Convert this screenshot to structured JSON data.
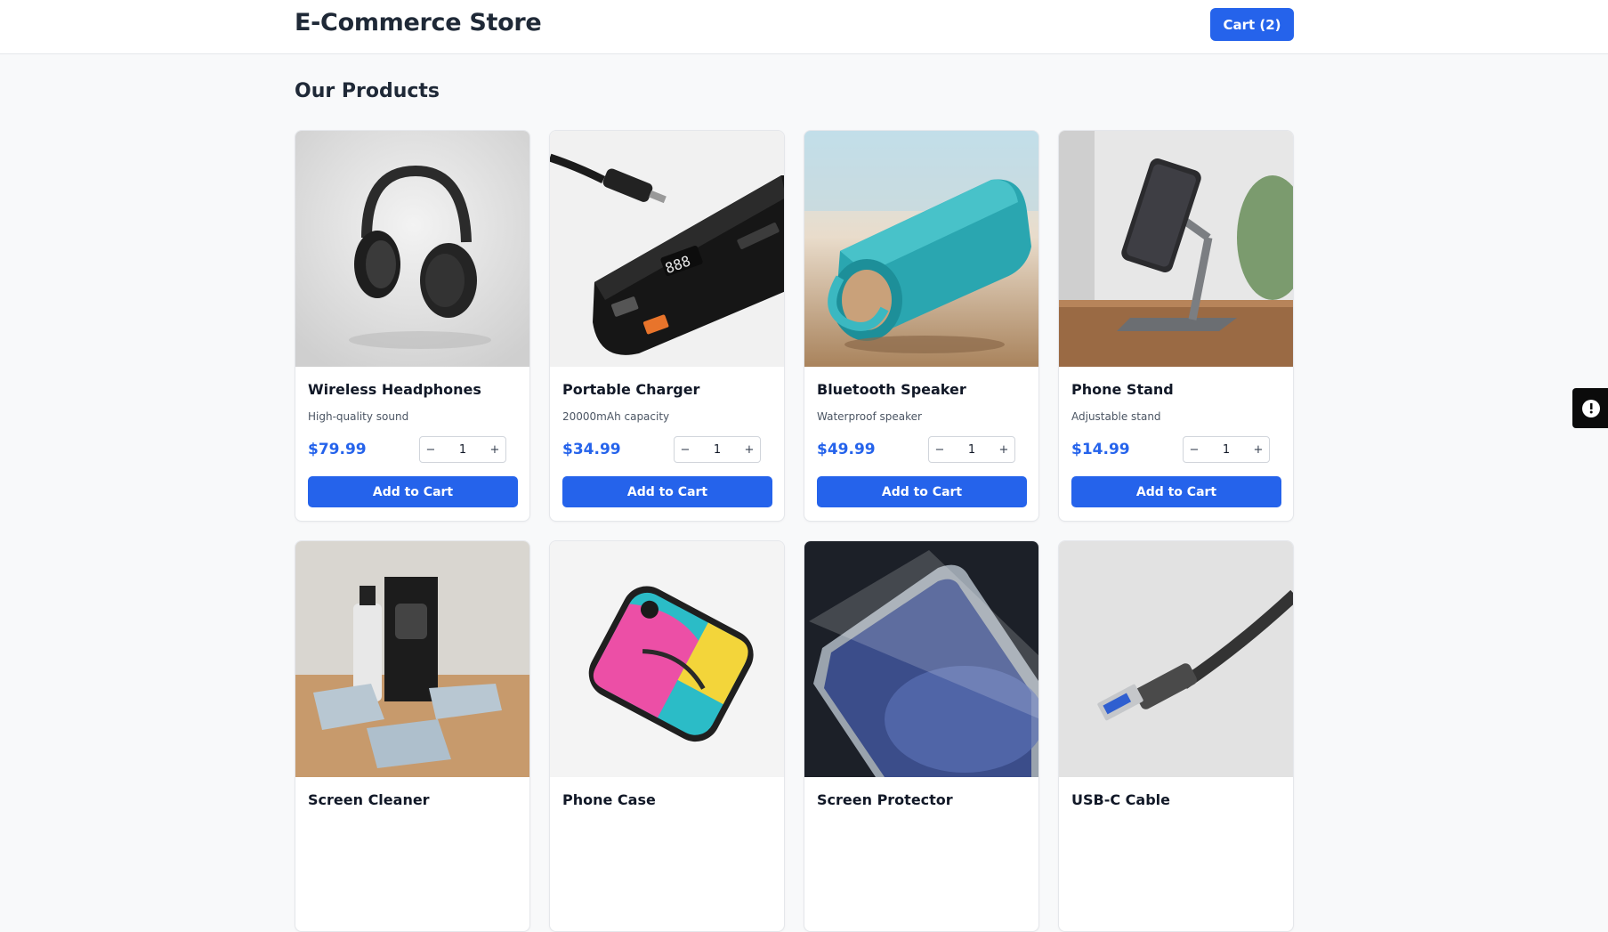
{
  "header": {
    "title": "E-Commerce Store",
    "cart_label": "Cart (2)"
  },
  "main": {
    "section_title": "Our Products"
  },
  "products": [
    {
      "name": "Wireless Headphones",
      "description": "High-quality sound",
      "price": "$79.99",
      "qty": "1",
      "add_label": "Add to Cart",
      "icon": "headphones-image"
    },
    {
      "name": "Portable Charger",
      "description": "20000mAh capacity",
      "price": "$34.99",
      "qty": "1",
      "add_label": "Add to Cart",
      "icon": "power-bank-image"
    },
    {
      "name": "Bluetooth Speaker",
      "description": "Waterproof speaker",
      "price": "$49.99",
      "qty": "1",
      "add_label": "Add to Cart",
      "icon": "speaker-image"
    },
    {
      "name": "Phone Stand",
      "description": "Adjustable stand",
      "price": "$14.99",
      "qty": "1",
      "add_label": "Add to Cart",
      "icon": "phone-stand-image"
    },
    {
      "name": "Screen Cleaner",
      "icon": "screen-cleaner-image"
    },
    {
      "name": "Phone Case",
      "icon": "phone-case-image"
    },
    {
      "name": "Screen Protector",
      "icon": "screen-protector-image"
    },
    {
      "name": "USB-C Cable",
      "icon": "usb-cable-image"
    }
  ],
  "qty_controls": {
    "decrement": "−",
    "increment": "+"
  },
  "colors": {
    "accent": "#2563eb",
    "background": "#f8f9fa"
  }
}
